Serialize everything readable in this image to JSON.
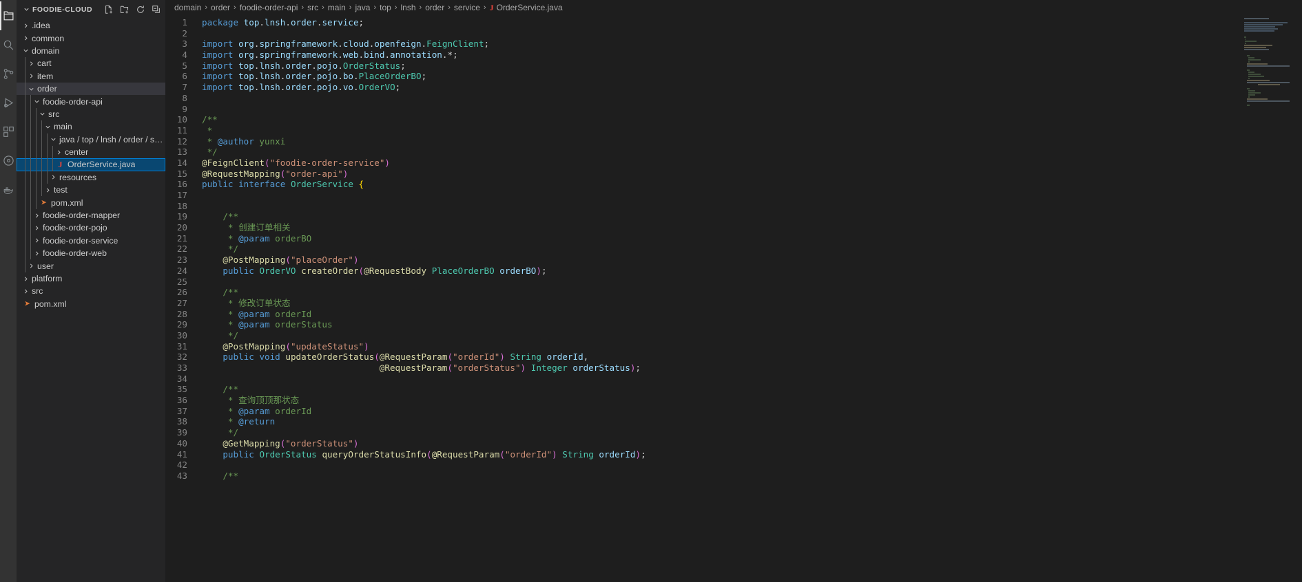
{
  "activitybar": {
    "items": [
      {
        "name": "explorer-icon",
        "title": "Explorer",
        "active": true
      },
      {
        "name": "search-icon",
        "title": "Search",
        "active": false
      },
      {
        "name": "source-control-icon",
        "title": "Source Control",
        "active": false
      },
      {
        "name": "run-debug-icon",
        "title": "Run and Debug",
        "active": false
      },
      {
        "name": "extensions-icon",
        "title": "Extensions",
        "active": false
      },
      {
        "name": "remote-explorer-icon",
        "title": "Remote Explorer",
        "active": false
      },
      {
        "name": "docker-icon",
        "title": "Docker",
        "active": false
      }
    ]
  },
  "sidebar": {
    "title": "FOODIE-CLOUD",
    "actions": [
      {
        "name": "new-file-icon",
        "title": "New File"
      },
      {
        "name": "new-folder-icon",
        "title": "New Folder"
      },
      {
        "name": "refresh-icon",
        "title": "Refresh Explorer"
      },
      {
        "name": "collapse-all-icon",
        "title": "Collapse Folders in Explorer"
      }
    ],
    "tree": [
      {
        "label": ".idea",
        "depth": 1,
        "type": "folder",
        "state": "collapsed"
      },
      {
        "label": "common",
        "depth": 1,
        "type": "folder",
        "state": "collapsed"
      },
      {
        "label": "domain",
        "depth": 1,
        "type": "folder",
        "state": "expanded"
      },
      {
        "label": "cart",
        "depth": 2,
        "type": "folder",
        "state": "collapsed"
      },
      {
        "label": "item",
        "depth": 2,
        "type": "folder",
        "state": "collapsed"
      },
      {
        "label": "order",
        "depth": 2,
        "type": "folder",
        "state": "expanded",
        "selected": true
      },
      {
        "label": "foodie-order-api",
        "depth": 3,
        "type": "folder",
        "state": "expanded"
      },
      {
        "label": "src",
        "depth": 4,
        "type": "folder",
        "state": "expanded"
      },
      {
        "label": "main",
        "depth": 5,
        "type": "folder",
        "state": "expanded"
      },
      {
        "label": "java / top / lnsh / order / s…",
        "depth": 6,
        "type": "folder",
        "state": "expanded"
      },
      {
        "label": "center",
        "depth": 7,
        "type": "folder",
        "state": "collapsed"
      },
      {
        "label": "OrderService.java",
        "depth": 7,
        "type": "java-file",
        "focused": true
      },
      {
        "label": "resources",
        "depth": 6,
        "type": "folder",
        "state": "collapsed"
      },
      {
        "label": "test",
        "depth": 5,
        "type": "folder",
        "state": "collapsed"
      },
      {
        "label": "pom.xml",
        "depth": 4,
        "type": "xml-file"
      },
      {
        "label": "foodie-order-mapper",
        "depth": 3,
        "type": "folder",
        "state": "collapsed"
      },
      {
        "label": "foodie-order-pojo",
        "depth": 3,
        "type": "folder",
        "state": "collapsed"
      },
      {
        "label": "foodie-order-service",
        "depth": 3,
        "type": "folder",
        "state": "collapsed"
      },
      {
        "label": "foodie-order-web",
        "depth": 3,
        "type": "folder",
        "state": "collapsed"
      },
      {
        "label": "user",
        "depth": 2,
        "type": "folder",
        "state": "collapsed"
      },
      {
        "label": "platform",
        "depth": 1,
        "type": "folder",
        "state": "collapsed"
      },
      {
        "label": "src",
        "depth": 1,
        "type": "folder",
        "state": "collapsed"
      },
      {
        "label": "pom.xml",
        "depth": 1,
        "type": "xml-file"
      }
    ]
  },
  "breadcrumb": {
    "segments": [
      "domain",
      "order",
      "foodie-order-api",
      "src",
      "main",
      "java",
      "top",
      "lnsh",
      "order",
      "service"
    ],
    "separator": "›",
    "file": "OrderService.java",
    "file_icon": "J"
  },
  "editor": {
    "language": "java",
    "first_line": 1,
    "lines": [
      {
        "n": 1,
        "text": "package top.lnsh.order.service;"
      },
      {
        "n": 2,
        "text": ""
      },
      {
        "n": 3,
        "text": "import org.springframework.cloud.openfeign.FeignClient;"
      },
      {
        "n": 4,
        "text": "import org.springframework.web.bind.annotation.*;"
      },
      {
        "n": 5,
        "text": "import top.lnsh.order.pojo.OrderStatus;"
      },
      {
        "n": 6,
        "text": "import top.lnsh.order.pojo.bo.PlaceOrderBO;"
      },
      {
        "n": 7,
        "text": "import top.lnsh.order.pojo.vo.OrderVO;"
      },
      {
        "n": 8,
        "text": ""
      },
      {
        "n": 9,
        "text": ""
      },
      {
        "n": 10,
        "text": "/**"
      },
      {
        "n": 11,
        "text": " *"
      },
      {
        "n": 12,
        "text": " * @author yunxi"
      },
      {
        "n": 13,
        "text": " */"
      },
      {
        "n": 14,
        "text": "@FeignClient(\"foodie-order-service\")"
      },
      {
        "n": 15,
        "text": "@RequestMapping(\"order-api\")"
      },
      {
        "n": 16,
        "text": "public interface OrderService {"
      },
      {
        "n": 17,
        "text": ""
      },
      {
        "n": 18,
        "text": ""
      },
      {
        "n": 19,
        "text": "    /**"
      },
      {
        "n": 20,
        "text": "     * 创建订单相关"
      },
      {
        "n": 21,
        "text": "     * @param orderBO"
      },
      {
        "n": 22,
        "text": "     */"
      },
      {
        "n": 23,
        "text": "    @PostMapping(\"placeOrder\")"
      },
      {
        "n": 24,
        "text": "    public OrderVO createOrder(@RequestBody PlaceOrderBO orderBO);"
      },
      {
        "n": 25,
        "text": ""
      },
      {
        "n": 26,
        "text": "    /**"
      },
      {
        "n": 27,
        "text": "     * 修改订单状态"
      },
      {
        "n": 28,
        "text": "     * @param orderId"
      },
      {
        "n": 29,
        "text": "     * @param orderStatus"
      },
      {
        "n": 30,
        "text": "     */"
      },
      {
        "n": 31,
        "text": "    @PostMapping(\"updateStatus\")"
      },
      {
        "n": 32,
        "text": "    public void updateOrderStatus(@RequestParam(\"orderId\") String orderId,"
      },
      {
        "n": 33,
        "text": "                                  @RequestParam(\"orderStatus\") Integer orderStatus);"
      },
      {
        "n": 34,
        "text": ""
      },
      {
        "n": 35,
        "text": "    /**"
      },
      {
        "n": 36,
        "text": "     * 查询顶顶那状态"
      },
      {
        "n": 37,
        "text": "     * @param orderId"
      },
      {
        "n": 38,
        "text": "     * @return"
      },
      {
        "n": 39,
        "text": "     */"
      },
      {
        "n": 40,
        "text": "    @GetMapping(\"orderStatus\")"
      },
      {
        "n": 41,
        "text": "    public OrderStatus queryOrderStatusInfo(@RequestParam(\"orderId\") String orderId);"
      },
      {
        "n": 42,
        "text": ""
      },
      {
        "n": 43,
        "text": "    /**"
      }
    ]
  },
  "colors": {
    "editor_background": "#1e1e1e",
    "sidebar_background": "#252526",
    "activitybar_background": "#333333",
    "selection_blue": "#094771",
    "focus_border": "#007fd4",
    "keyword": "#569cd6",
    "string": "#ce9178",
    "comment": "#6a9955",
    "type": "#4ec9b0",
    "annotation": "#dcdcaa",
    "variable": "#9cdcfe",
    "line_number": "#858585"
  }
}
